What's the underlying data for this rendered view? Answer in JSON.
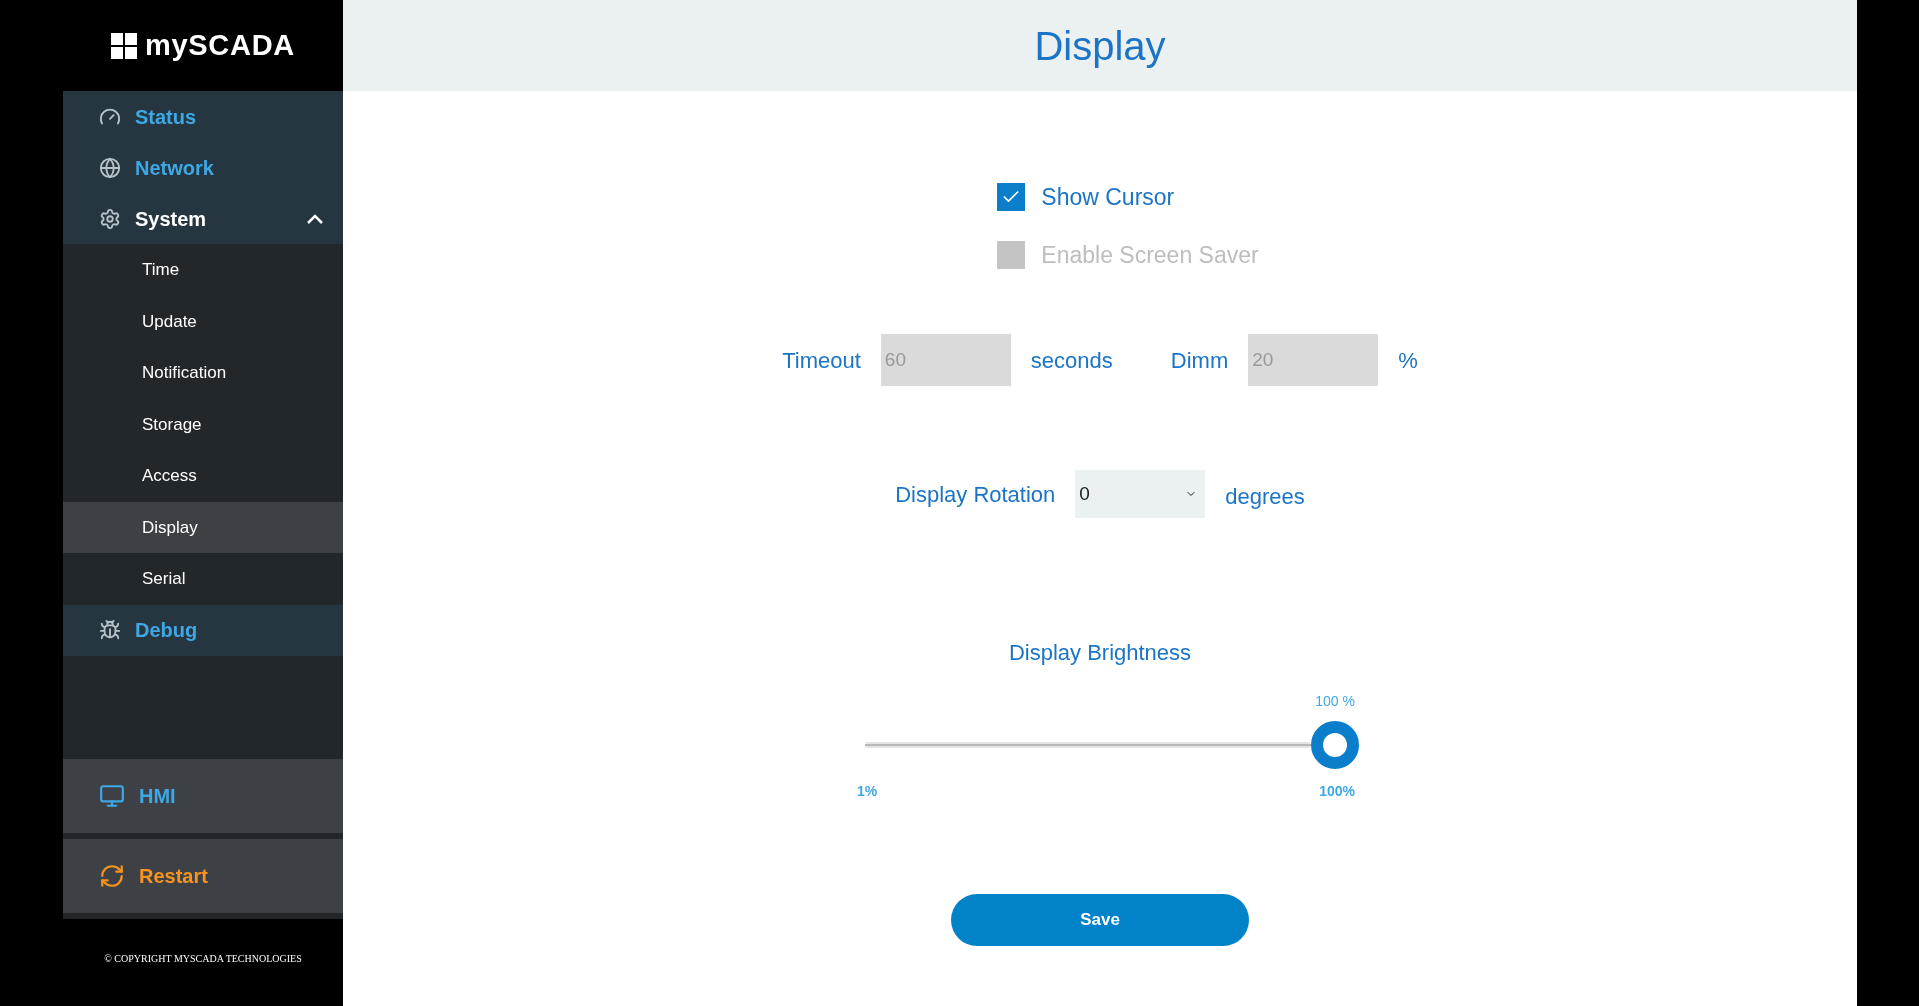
{
  "logo": {
    "text": "mySCADA"
  },
  "sidebar": {
    "items": [
      {
        "label": "Status",
        "expanded": false,
        "selected": false
      },
      {
        "label": "Network",
        "expanded": false,
        "selected": false
      },
      {
        "label": "System",
        "expanded": true,
        "selected": false,
        "children": [
          {
            "label": "Time",
            "selected": false
          },
          {
            "label": "Update",
            "selected": false
          },
          {
            "label": "Notification",
            "selected": false
          },
          {
            "label": "Storage",
            "selected": false
          },
          {
            "label": "Access",
            "selected": false
          },
          {
            "label": "Display",
            "selected": true
          },
          {
            "label": "Serial",
            "selected": false
          }
        ]
      },
      {
        "label": "Debug",
        "expanded": false,
        "selected": false
      }
    ],
    "bottom_buttons": [
      {
        "label": "HMI",
        "kind": "hmi"
      },
      {
        "label": "Restart",
        "kind": "restart"
      }
    ],
    "copyright": "© COPYRIGHT MYSCADA TECHNOLOGIES"
  },
  "header": {
    "title": "Display"
  },
  "checkboxes": [
    {
      "label": "Show Cursor",
      "checked": true,
      "disabled": false
    },
    {
      "label": "Enable Screen Saver",
      "checked": false,
      "disabled": true
    }
  ],
  "timeout": {
    "label": "Timeout",
    "value": "60",
    "unit": "seconds",
    "disabled": true
  },
  "dimm": {
    "label": "Dimm",
    "value": "20",
    "unit": "%",
    "disabled": true
  },
  "rotation": {
    "label": "Display Rotation",
    "value": "0",
    "unit": "degrees"
  },
  "brightness": {
    "title": "Display Brightness",
    "reading": "100 %",
    "level": 1,
    "min_label": "1%",
    "max_label": "100%"
  },
  "save_button": {
    "label": "Save"
  }
}
